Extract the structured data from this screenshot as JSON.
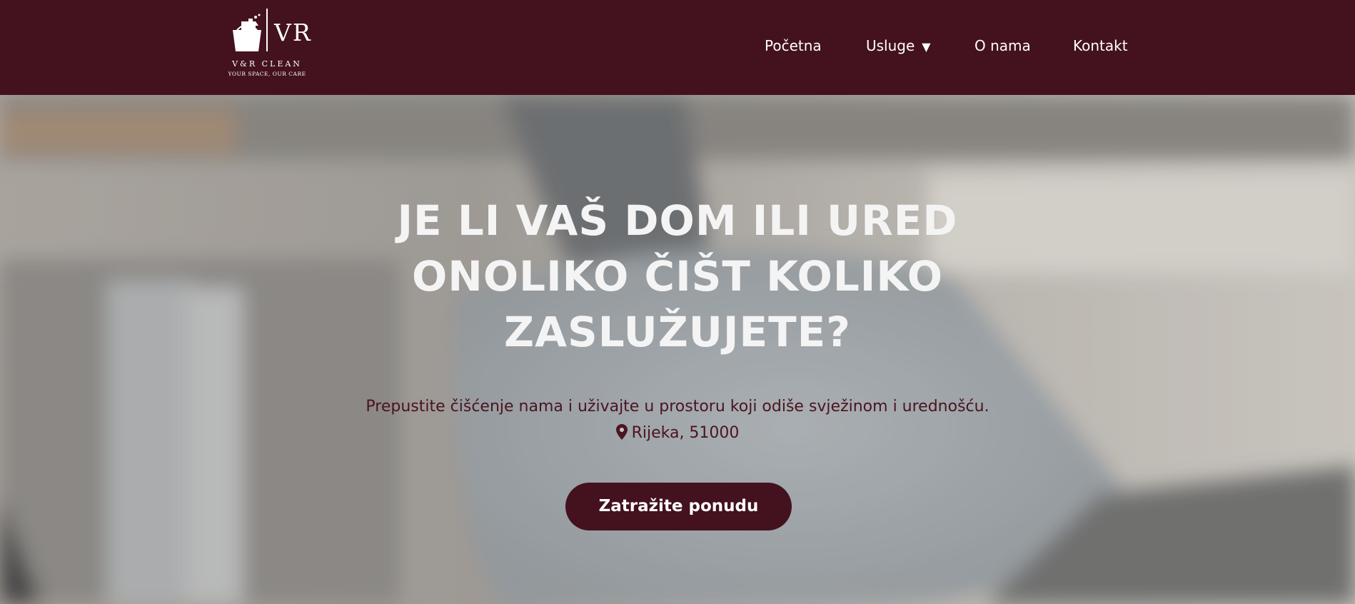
{
  "brand": {
    "logo_letters": "VR",
    "name": "V&R CLEAN",
    "tagline": "YOUR SPACE, OUR CARE"
  },
  "nav": {
    "items": [
      {
        "label": "Početna"
      },
      {
        "label": "Usluge",
        "caret": "▼"
      },
      {
        "label": "O nama"
      },
      {
        "label": "Kontakt"
      }
    ]
  },
  "hero": {
    "title_lines": [
      "JE LI VAŠ DOM ILI URED",
      "ONOLIKO ČIŠT KOLIKO",
      "ZASLUŽUJETE?"
    ],
    "subtitle": "Prepustite čišćenje nama i uživajte u prostoru koji odiše svježinom i urednošću.",
    "location": "Rijeka, 51000",
    "cta_label": "Zatražite ponudu"
  },
  "colors": {
    "brand": "#43121e",
    "hero_text": "#f4f4f4",
    "subtitle_text": "#4a1420"
  },
  "icons": {
    "location": "map-pin-icon",
    "dropdown": "caret-down-icon",
    "logo": "cleaning-caddy-icon"
  }
}
